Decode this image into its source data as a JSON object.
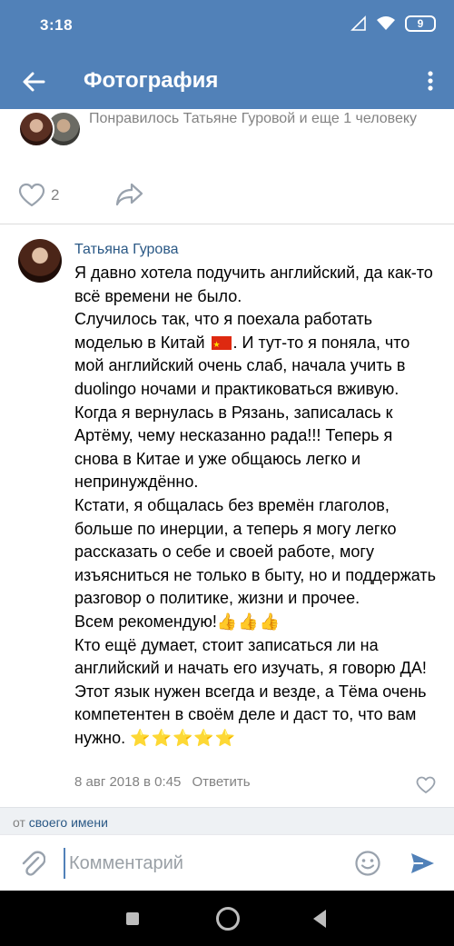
{
  "status_bar": {
    "time": "3:18",
    "battery": "9",
    "icons": [
      "signal-icon",
      "wifi-icon",
      "battery-icon"
    ]
  },
  "app_bar": {
    "title": "Фотография",
    "back_icon": "arrow-back-icon",
    "more_icon": "more-vertical-icon",
    "background": "#5181b8"
  },
  "likes_summary": {
    "text": "Понравилось Татьяне Гуровой и еще 1 человеку"
  },
  "post_actions": {
    "like_count": "2",
    "like_icon": "heart-outline-icon",
    "share_icon": "share-arrow-icon"
  },
  "comment": {
    "author": "Татьяна Гурова",
    "text_part1": "Я давно хотела подучить английский, да как-то всё времени не было.\nСлучилось так, что я поехала работать моделью в Китай ",
    "text_part2": ". И тут-то я поняла, что мой английский очень слаб, начала учить в duolingo ночами и практиковаться вживую.\nКогда я вернулась в Рязань, записалась к Артёму, чему несказанно рада!!! Теперь я снова в Китае и уже общаюсь легко и непринуждённо.\nКстати, я общалась без времён глаголов, больше по инерции, а теперь я могу легко рассказать о себе и своей работе, могу изъясниться не только в быту, но и поддержать разговор о политике, жизни и прочее.\nВсем рекомендую!",
    "thumbs": "👍👍👍",
    "text_part3": "\nКто ещё думает, стоит записаться ли на английский и начать его изучать, я говорю ДА! Этот язык нужен всегда и везде, а Тёма очень компетентен в своём деле и даст то, что вам нужно. ",
    "stars": "⭐⭐⭐⭐⭐",
    "date": "8 авг 2018 в 0:45",
    "reply_label": "Ответить",
    "author_color": "#2a5885"
  },
  "from_bar": {
    "prefix": "от",
    "link": "своего имени"
  },
  "composer": {
    "placeholder": "Комментарий",
    "attach_icon": "paperclip-icon",
    "emoji_icon": "smiley-icon",
    "send_icon": "send-icon"
  },
  "nav_bar": {
    "icons": [
      "recents-square-icon",
      "home-circle-icon",
      "back-triangle-icon"
    ]
  }
}
